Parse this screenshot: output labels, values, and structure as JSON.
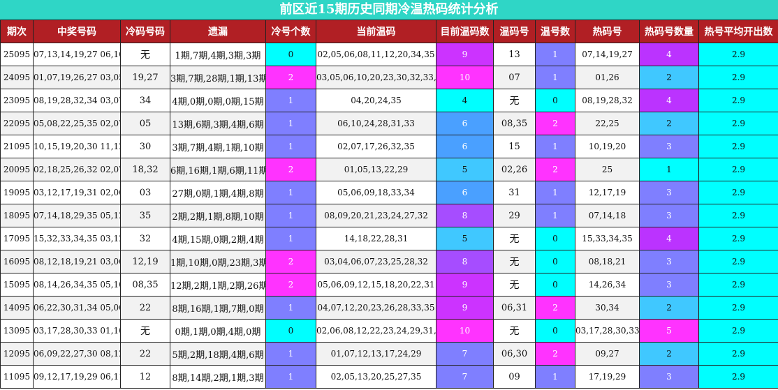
{
  "title": "前区近15期历史同期冷温热码统计分析",
  "colors": {
    "header_bg": "#b11f24",
    "title_bg": "#2fd6c6",
    "c0": "#00ffff",
    "c1": "#7f7fff",
    "c2": "#ff33ff",
    "c4": "#00ffff",
    "c5": "#40c8ff",
    "c6": "#4aa0ff",
    "c8": "#a64dff",
    "c9": "#cc33ff",
    "c10": "#ff33ff",
    "hot1": "#00ffff",
    "hot2": "#40c8ff",
    "hot3": "#7f7fff",
    "hot4": "#bb33ff",
    "hot5": "#ff33ff"
  },
  "headers": [
    "期次",
    "中奖号码",
    "冷码号码",
    "遗漏",
    "冷号个数",
    "当前温码",
    "目前温码数",
    "温码号",
    "温号数",
    "热码号",
    "热码号数量",
    "热号平均开出数"
  ],
  "rows": [
    {
      "period": "25095",
      "numbers": "07,13,14,19,27 06,10",
      "cold": "无",
      "missing": "1期,7期,4期,3期,3期",
      "cold_count": "0",
      "warm_codes": "02,05,06,08,11,12,20,34,35",
      "warm_count": "9",
      "warm_nums": "13",
      "warm_num_count": "1",
      "hot": "07,14,19,27",
      "hot_count": "4",
      "hot_avg": "2.9"
    },
    {
      "period": "24095",
      "numbers": "01,07,19,26,27 03,05",
      "cold": "19,27",
      "missing": "3期,7期,28期,1期,13期",
      "cold_count": "2",
      "warm_codes": "03,05,06,10,20,23,30,32,33,34",
      "warm_count": "10",
      "warm_nums": "07",
      "warm_num_count": "1",
      "hot": "01,26",
      "hot_count": "2",
      "hot_avg": "2.9"
    },
    {
      "period": "23095",
      "numbers": "08,19,28,32,34 03,07",
      "cold": "34",
      "missing": "4期,0期,0期,0期,15期",
      "cold_count": "1",
      "warm_codes": "04,20,24,35",
      "warm_count": "4",
      "warm_nums": "无",
      "warm_num_count": "0",
      "hot": "08,19,28,32",
      "hot_count": "4",
      "hot_avg": "2.9"
    },
    {
      "period": "22095",
      "numbers": "05,08,22,25,35 02,07",
      "cold": "05",
      "missing": "13期,6期,3期,4期,6期",
      "cold_count": "1",
      "warm_codes": "06,10,24,28,31,33",
      "warm_count": "6",
      "warm_nums": "08,35",
      "warm_num_count": "2",
      "hot": "22,25",
      "hot_count": "2",
      "hot_avg": "2.9"
    },
    {
      "period": "21095",
      "numbers": "10,15,19,20,30 11,12",
      "cold": "30",
      "missing": "3期,7期,4期,1期,10期",
      "cold_count": "1",
      "warm_codes": "02,07,17,26,32,35",
      "warm_count": "6",
      "warm_nums": "15",
      "warm_num_count": "1",
      "hot": "10,19,20",
      "hot_count": "3",
      "hot_avg": "2.9"
    },
    {
      "period": "20095",
      "numbers": "02,18,25,26,32 02,07",
      "cold": "18,32",
      "missing": "6期,16期,1期,6期,11期",
      "cold_count": "2",
      "warm_codes": "01,05,13,22,29",
      "warm_count": "5",
      "warm_nums": "02,26",
      "warm_num_count": "2",
      "hot": "25",
      "hot_count": "1",
      "hot_avg": "2.9"
    },
    {
      "period": "19095",
      "numbers": "03,12,17,19,31 02,06",
      "cold": "03",
      "missing": "27期,0期,1期,4期,8期",
      "cold_count": "1",
      "warm_codes": "05,06,09,18,33,34",
      "warm_count": "6",
      "warm_nums": "31",
      "warm_num_count": "1",
      "hot": "12,17,19",
      "hot_count": "3",
      "hot_avg": "2.9"
    },
    {
      "period": "18095",
      "numbers": "07,14,18,29,35 05,12",
      "cold": "35",
      "missing": "2期,2期,1期,8期,10期",
      "cold_count": "1",
      "warm_codes": "08,09,20,21,23,24,27,32",
      "warm_count": "8",
      "warm_nums": "29",
      "warm_num_count": "1",
      "hot": "07,14,18",
      "hot_count": "3",
      "hot_avg": "2.9"
    },
    {
      "period": "17095",
      "numbers": "15,32,33,34,35 03,12",
      "cold": "32",
      "missing": "4期,15期,0期,2期,4期",
      "cold_count": "1",
      "warm_codes": "14,18,22,28,31",
      "warm_count": "5",
      "warm_nums": "无",
      "warm_num_count": "0",
      "hot": "15,33,34,35",
      "hot_count": "4",
      "hot_avg": "2.9"
    },
    {
      "period": "16095",
      "numbers": "08,12,18,19,21 03,06",
      "cold": "12,19",
      "missing": "1期,10期,0期,23期,3期",
      "cold_count": "2",
      "warm_codes": "03,04,06,07,23,25,28,32",
      "warm_count": "8",
      "warm_nums": "无",
      "warm_num_count": "0",
      "hot": "08,18,21",
      "hot_count": "3",
      "hot_avg": "2.9"
    },
    {
      "period": "15095",
      "numbers": "08,14,26,34,35 05,10",
      "cold": "08,35",
      "missing": "12期,2期,1期,2期,26期",
      "cold_count": "2",
      "warm_codes": "05,06,09,12,15,18,20,22,31",
      "warm_count": "9",
      "warm_nums": "无",
      "warm_num_count": "0",
      "hot": "14,26,34",
      "hot_count": "3",
      "hot_avg": "2.9"
    },
    {
      "period": "14095",
      "numbers": "06,22,30,31,34 05,06",
      "cold": "22",
      "missing": "8期,16期,1期,7期,0期",
      "cold_count": "1",
      "warm_codes": "04,07,12,20,23,26,28,33,35",
      "warm_count": "9",
      "warm_nums": "06,31",
      "warm_num_count": "2",
      "hot": "30,34",
      "hot_count": "2",
      "hot_avg": "2.9"
    },
    {
      "period": "13095",
      "numbers": "03,17,28,30,33 01,10",
      "cold": "无",
      "missing": "0期,1期,0期,4期,0期",
      "cold_count": "0",
      "warm_codes": "02,06,08,12,22,23,24,29,31,32",
      "warm_count": "10",
      "warm_nums": "无",
      "warm_num_count": "0",
      "hot": "03,17,28,30,33",
      "hot_count": "5",
      "hot_avg": "2.9"
    },
    {
      "period": "12095",
      "numbers": "06,09,22,27,30 08,12",
      "cold": "22",
      "missing": "5期,2期,18期,4期,6期",
      "cold_count": "1",
      "warm_codes": "01,07,12,13,17,24,29",
      "warm_count": "7",
      "warm_nums": "06,30",
      "warm_num_count": "2",
      "hot": "09,27",
      "hot_count": "2",
      "hot_avg": "2.9"
    },
    {
      "period": "11095",
      "numbers": "09,12,17,19,29 06,11",
      "cold": "12",
      "missing": "8期,14期,2期,1期,3期",
      "cold_count": "1",
      "warm_codes": "02,05,13,20,25,27,35",
      "warm_count": "7",
      "warm_nums": "09",
      "warm_num_count": "1",
      "hot": "17,19,29",
      "hot_count": "3",
      "hot_avg": "2.9"
    }
  ]
}
